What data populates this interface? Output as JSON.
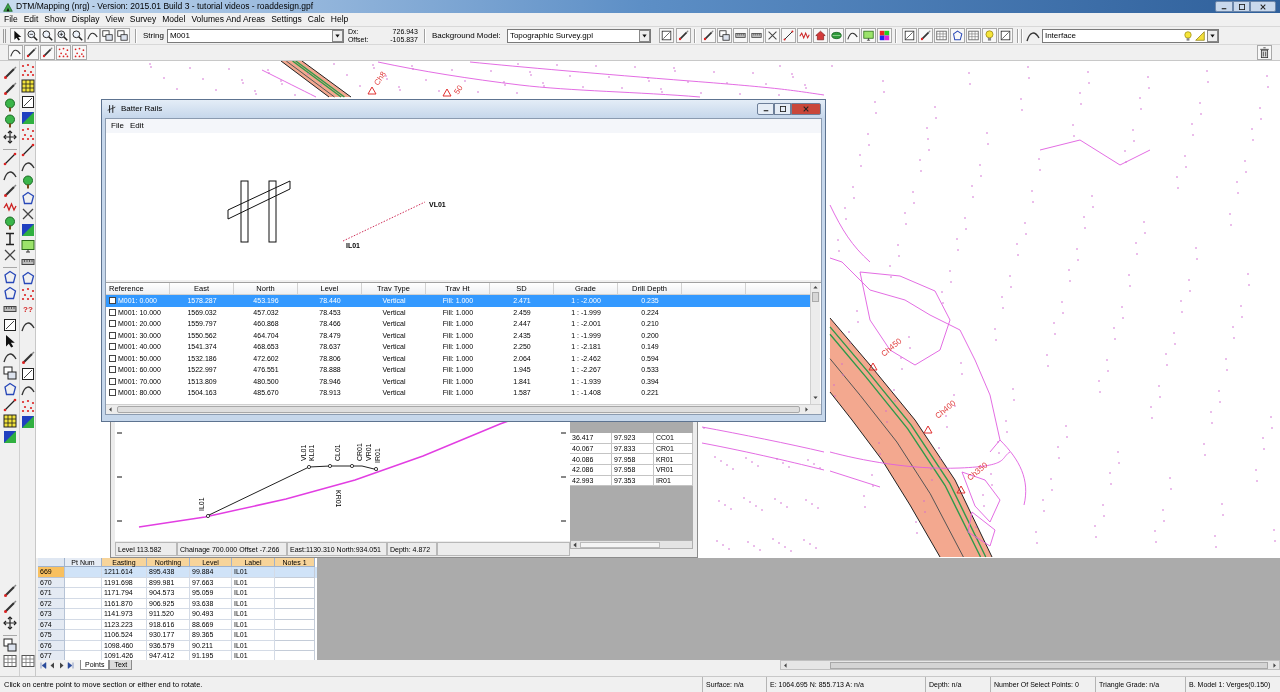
{
  "window": {
    "title": "DTM/Mapping (nrg) - Version: 2015.01 Build 3 - tutorial videos - roaddesign.gpf"
  },
  "menu": [
    "File",
    "Edit",
    "Show",
    "Display",
    "View",
    "Survey",
    "Model",
    "Volumes And Areas",
    "Settings",
    "Calc",
    "Help"
  ],
  "toolbar": {
    "string_label": "String",
    "string_value": "M001",
    "dx_label": "Dx:",
    "offset_label": "Offset:",
    "dx_value": "726.943",
    "offset_value": "-105.837",
    "background_model_label": "Background Model:",
    "background_model_value": "Topographic Survey.gpl",
    "layer_value": "Interface"
  },
  "side_toolbar": {
    "glyph": "??"
  },
  "map": {
    "labels": [
      "Ch8",
      "50",
      "Ch450",
      "Ch400",
      "Ch350"
    ]
  },
  "batter_rails": {
    "title": "Batter Rails",
    "menu": [
      "File",
      "Edit"
    ],
    "preview": {
      "start_label": "IL01",
      "end_label": "VL01"
    },
    "table": {
      "columns": [
        "Reference",
        "East",
        "North",
        "Level",
        "Trav Type",
        "Trav Ht",
        "SD",
        "Grade",
        "Drill Depth"
      ],
      "rows": [
        {
          "checked": false,
          "selected": true,
          "cells": [
            "M001: 0.000",
            "1578.287",
            "453.196",
            "78.440",
            "Vertical",
            "Fill: 1.000",
            "2.471",
            "1 : -2.000",
            "0.235"
          ]
        },
        {
          "checked": false,
          "selected": false,
          "cells": [
            "M001: 10.000",
            "1569.032",
            "457.032",
            "78.453",
            "Vertical",
            "Fill: 1.000",
            "2.459",
            "1 : -1.999",
            "0.224"
          ]
        },
        {
          "checked": false,
          "selected": false,
          "cells": [
            "M001: 20.000",
            "1559.797",
            "460.868",
            "78.466",
            "Vertical",
            "Fill: 1.000",
            "2.447",
            "1 : -2.001",
            "0.210"
          ]
        },
        {
          "checked": false,
          "selected": false,
          "cells": [
            "M001: 30.000",
            "1550.562",
            "464.704",
            "78.479",
            "Vertical",
            "Fill: 1.000",
            "2.435",
            "1 : -1.999",
            "0.200"
          ]
        },
        {
          "checked": false,
          "selected": false,
          "cells": [
            "M001: 40.000",
            "1541.374",
            "468.653",
            "78.637",
            "Vertical",
            "Fill: 1.000",
            "2.250",
            "1 : -2.181",
            "0.149"
          ]
        },
        {
          "checked": false,
          "selected": false,
          "cells": [
            "M001: 50.000",
            "1532.186",
            "472.602",
            "78.806",
            "Vertical",
            "Fill: 1.000",
            "2.064",
            "1 : -2.462",
            "0.594"
          ]
        },
        {
          "checked": false,
          "selected": false,
          "cells": [
            "M001: 60.000",
            "1522.997",
            "476.551",
            "78.888",
            "Vertical",
            "Fill: 1.000",
            "1.945",
            "1 : -2.267",
            "0.533"
          ]
        },
        {
          "checked": false,
          "selected": false,
          "cells": [
            "M001: 70.000",
            "1513.809",
            "480.500",
            "78.946",
            "Vertical",
            "Fill: 1.000",
            "1.841",
            "1 : -1.939",
            "0.394"
          ]
        },
        {
          "checked": false,
          "selected": false,
          "cells": [
            "M001: 80.000",
            "1504.163",
            "485.670",
            "78.913",
            "Vertical",
            "Fill: 1.000",
            "1.587",
            "1 : -1.408",
            "0.221"
          ]
        }
      ]
    }
  },
  "section": {
    "profile_labels": [
      "IL01",
      "VL01",
      "KL01",
      "CL01",
      "CR01",
      "KR01",
      "VR01",
      "IR01"
    ],
    "points": [
      [
        "36.417",
        "97.923",
        "CC01"
      ],
      [
        "40.067",
        "97.833",
        "CR01"
      ],
      [
        "40.086",
        "97.958",
        "KR01"
      ],
      [
        "42.086",
        "97.958",
        "VR01"
      ],
      [
        "42.993",
        "97.353",
        "IR01"
      ]
    ],
    "status": [
      "Level 113.582",
      "Chainage 700.000 Offset -7.266",
      "East:1130.310 North:934.051",
      "Depth: 4.872"
    ]
  },
  "points": {
    "columns": [
      {
        "label": "Pt Num",
        "highlighted": false
      },
      {
        "label": "Easting",
        "highlighted": true
      },
      {
        "label": "Northing",
        "highlighted": true
      },
      {
        "label": "Level",
        "highlighted": true
      },
      {
        "label": "Label",
        "highlighted": true
      },
      {
        "label": "Notes 1",
        "highlighted": true
      }
    ],
    "rows": [
      {
        "number": "669",
        "selected": true,
        "values": [
          "1211.614",
          "895.438",
          "99.884",
          "IL01"
        ]
      },
      {
        "number": "670",
        "selected": false,
        "values": [
          "1191.698",
          "899.981",
          "97.663",
          "IL01"
        ]
      },
      {
        "number": "671",
        "selected": false,
        "values": [
          "1171.794",
          "904.573",
          "95.059",
          "IL01"
        ]
      },
      {
        "number": "672",
        "selected": false,
        "values": [
          "1161.870",
          "906.925",
          "93.638",
          "IL01"
        ]
      },
      {
        "number": "673",
        "selected": false,
        "values": [
          "1141.973",
          "911.520",
          "90.493",
          "IL01"
        ]
      },
      {
        "number": "674",
        "selected": false,
        "values": [
          "1123.223",
          "918.616",
          "88.669",
          "IL01"
        ]
      },
      {
        "number": "675",
        "selected": false,
        "values": [
          "1106.524",
          "930.177",
          "89.365",
          "IL01"
        ]
      },
      {
        "number": "676",
        "selected": false,
        "values": [
          "1098.460",
          "936.579",
          "90.211",
          "IL01"
        ]
      },
      {
        "number": "677",
        "selected": false,
        "values": [
          "1091.426",
          "947.412",
          "91.195",
          "IL01"
        ]
      }
    ],
    "tabs": [
      {
        "label": "Points",
        "selected": true
      },
      {
        "label": "Text",
        "selected": false
      }
    ]
  },
  "status_bar": {
    "hint": "Click on centre point to move section or either end to rotate.",
    "fields": [
      "Surface: n/a",
      "E: 1064.695 N: 855.713 A: n/a",
      "Depth: n/a",
      "Number Of Select Points: 0",
      "Triangle Grade: n/a",
      "B. Model 1: Verges(0.150)"
    ]
  }
}
